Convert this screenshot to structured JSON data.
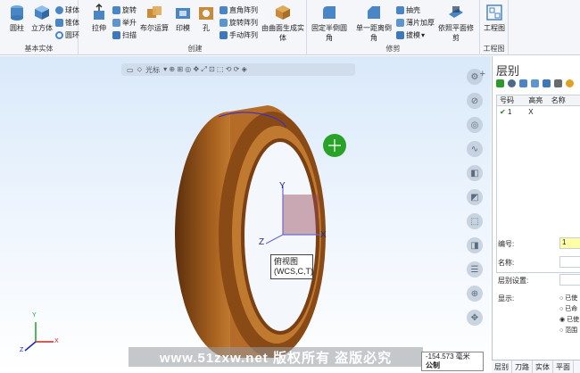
{
  "ribbon": {
    "groups": {
      "basic_solids": "基本实体",
      "create": "创建",
      "modify": "修剪",
      "drawing": "工程图"
    },
    "buttons": {
      "cylinder": "圆柱",
      "cube": "立方体",
      "sphere": "球体",
      "cone": "锥体",
      "torus": "圆环",
      "extrude": "拉伸",
      "revolve": "旋转",
      "loft": "举升",
      "sweep": "扫描",
      "boolean": "布尔运算",
      "imprint": "印模",
      "hole": "孔",
      "rect_array": "直角阵列",
      "rotate_array": "旋转阵列",
      "manual_array": "手动阵列",
      "surface_to_solid": "由曲面生成实体",
      "fixed_radius_fillet": "固定半倒圆角",
      "single_distance_chamfer": "单一距离倒角",
      "shell": "抽壳",
      "thicken": "薄片加厚",
      "draft": "拔模",
      "trim_by_plane": "依照平面修剪",
      "drawing": "工程图"
    }
  },
  "viewport": {
    "toolbar_label": "光标",
    "axis_x": "X",
    "axis_y": "Y",
    "axis_z": "Z",
    "tooltip_line1": "俯视图",
    "tooltip_line2": "(WCS,C,T)",
    "watermark": "www.51zxw.net  版权所有 盗版必究",
    "status_value": "-154.573 毫米",
    "status_unit": "公制"
  },
  "panel": {
    "title": "层别",
    "columns": [
      "号码",
      "高亮",
      "名称"
    ],
    "rows": [
      {
        "number": "1",
        "highlight": "X",
        "name": ""
      }
    ],
    "props": {
      "number_label": "编号:",
      "number_value": "1",
      "name_label": "名称:",
      "layer_set_label": "层别设置:",
      "display_label": "显示:"
    },
    "display_options": [
      "已使",
      "已命",
      "已使",
      "范围"
    ],
    "tabs": [
      "层别",
      "刀路",
      "实体",
      "平面"
    ]
  }
}
